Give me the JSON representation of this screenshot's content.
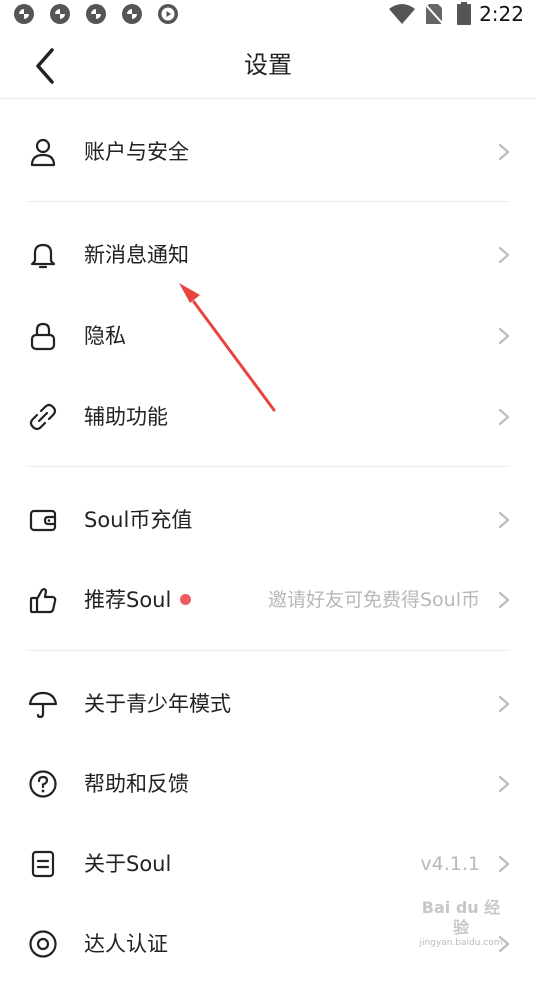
{
  "status_bar": {
    "time": "2:22",
    "notification_icons": [
      "soul-notify-icon",
      "soul-notify-icon",
      "soul-notify-icon",
      "soul-notify-icon",
      "play-notify-icon"
    ],
    "system_icons": [
      "wifi-icon",
      "no-sim-icon",
      "battery-icon"
    ]
  },
  "header": {
    "title": "设置",
    "back_icon": "chevron-left-icon"
  },
  "items": [
    {
      "label": "账户与安全",
      "icon": "user-icon"
    },
    {
      "label": "新消息通知",
      "icon": "bell-icon"
    },
    {
      "label": "隐私",
      "icon": "lock-icon"
    },
    {
      "label": "辅助功能",
      "icon": "link-icon"
    },
    {
      "label": "Soul币充值",
      "icon": "wallet-icon"
    },
    {
      "label": "推荐Soul",
      "icon": "thumbs-up-icon",
      "value": "邀请好友可免费得Soul币",
      "badge": "red-dot"
    },
    {
      "label": "关于青少年模式",
      "icon": "umbrella-icon"
    },
    {
      "label": "帮助和反馈",
      "icon": "help-icon"
    },
    {
      "label": "关于Soul",
      "icon": "document-icon",
      "value": "v4.1.1"
    },
    {
      "label": "达人认证",
      "icon": "verify-icon"
    }
  ],
  "annotation": {
    "type": "red-arrow",
    "target": "新消息通知",
    "color": "#e8433f"
  },
  "watermark": {
    "text": "Bai du 经验",
    "url": "jingyan.baidu.com"
  },
  "colors": {
    "accent_dot": "#f05a62",
    "secondary_text": "#b8b8b8",
    "divider": "#ececec"
  }
}
